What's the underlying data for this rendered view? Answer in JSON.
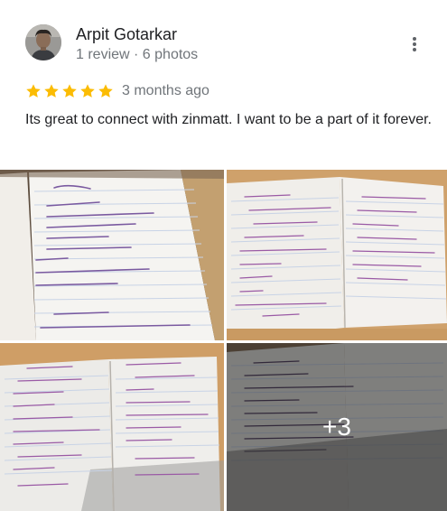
{
  "reviewer": {
    "name": "Arpit Gotarkar",
    "meta": "1 review · 6 photos"
  },
  "review": {
    "rating": 5,
    "rating_max": 5,
    "date": "3 months ago",
    "text": "Its great to connect with zinmatt. I want to be a part of it forever."
  },
  "photos": {
    "more_count_label": "+3"
  },
  "icons": {
    "more": "more-vert-icon",
    "star": "star-icon"
  },
  "colors": {
    "star": "#fbbc04",
    "primary_text": "#202124",
    "secondary_text": "#70757a"
  }
}
